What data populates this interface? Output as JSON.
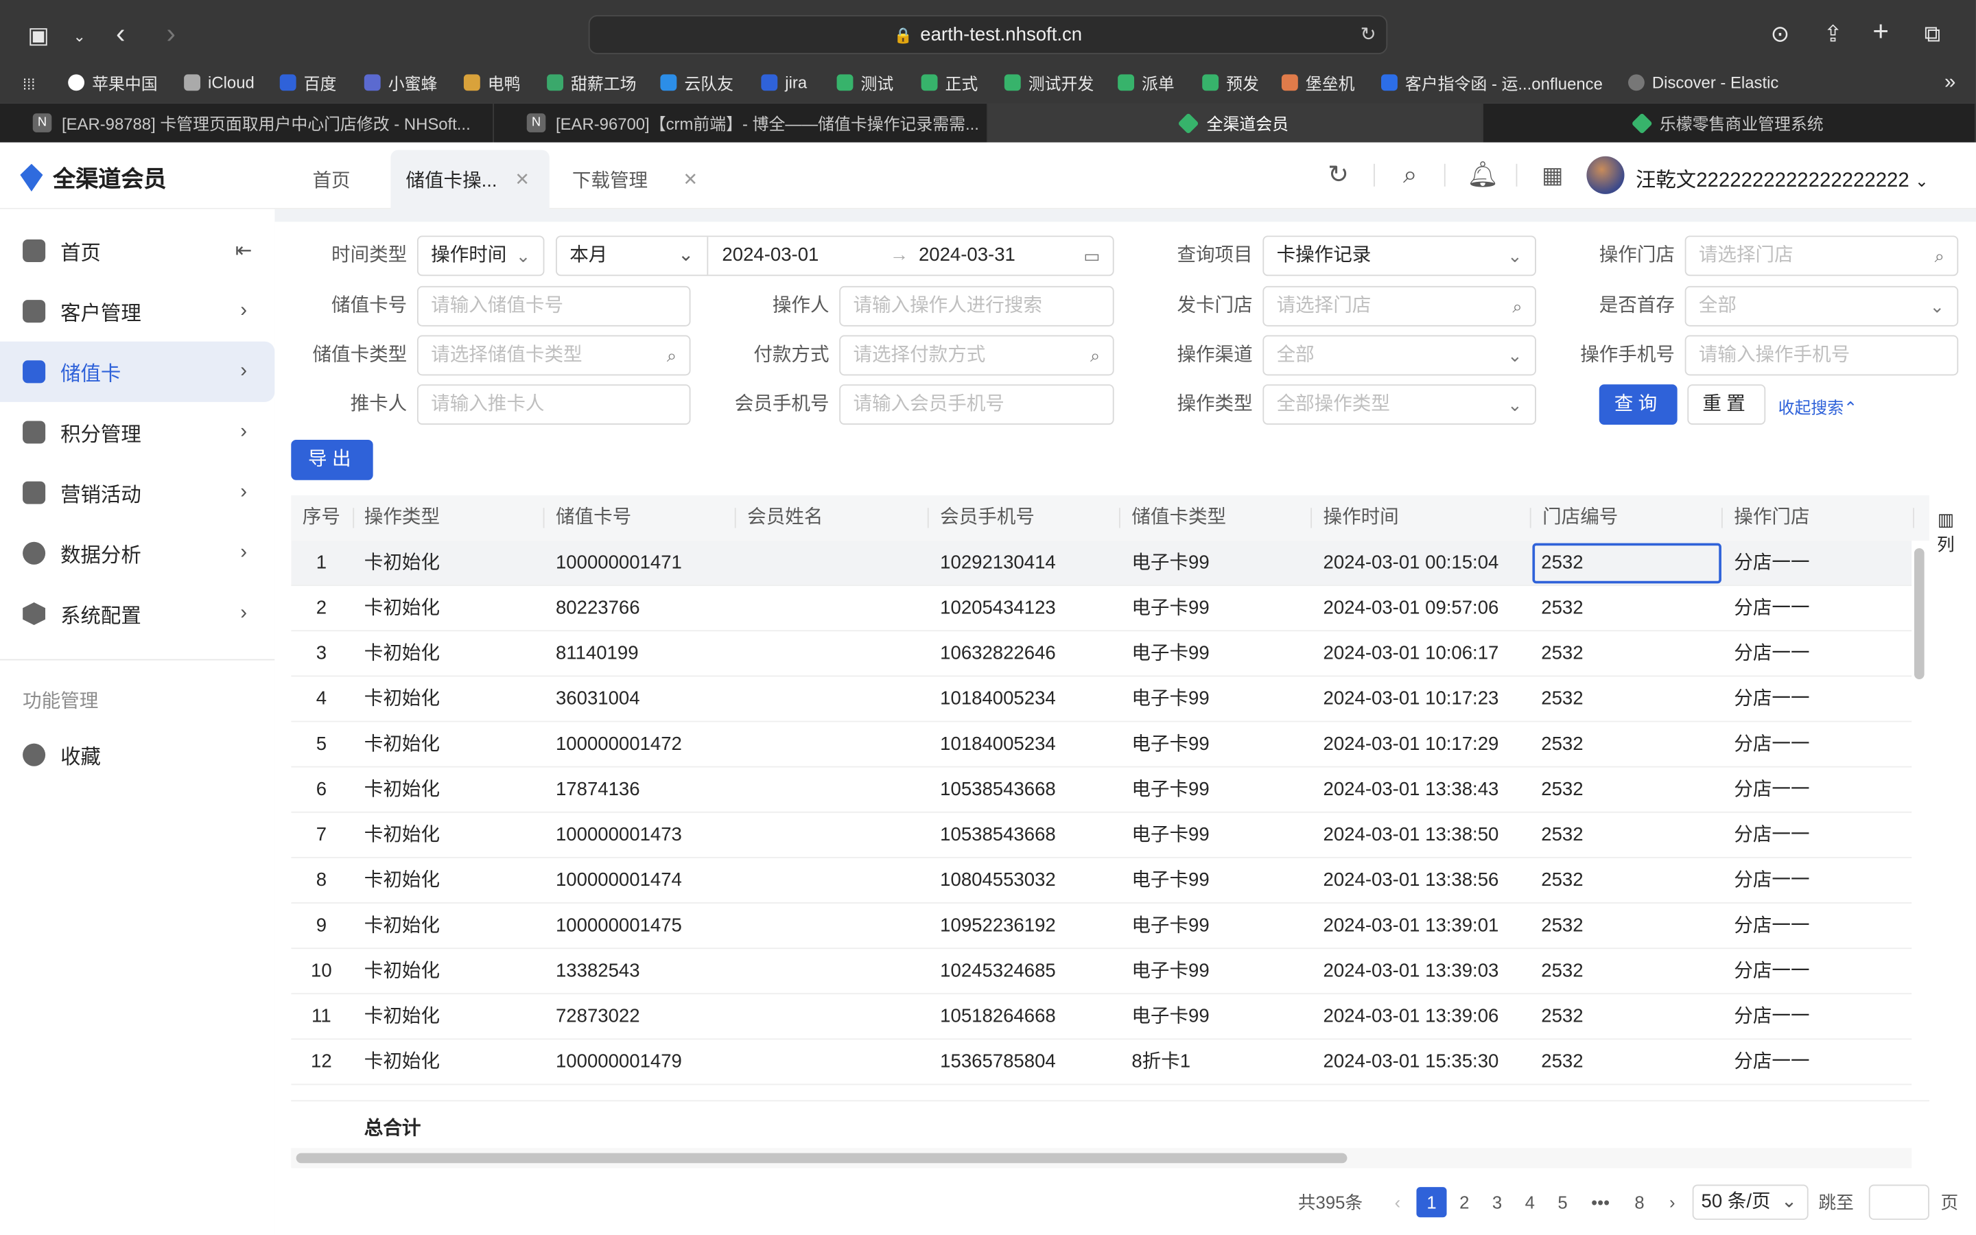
{
  "browser": {
    "url": "earth-test.nhsoft.cn",
    "bookmarks": [
      "苹果中国",
      "iCloud",
      "百度",
      "小蜜蜂",
      "电鸭",
      "甜薪工场",
      "云队友",
      "jira",
      "测试",
      "正式",
      "测试开发",
      "派单",
      "预发",
      "堡垒机",
      "客户指令函 - 运...onfluence",
      "Discover - Elastic"
    ],
    "tabs": [
      "[EAR-98788] 卡管理页面取用户中心门店修改 - NHSoft...",
      "[EAR-96700]【crm前端】- 博全——储值卡操作记录需需...",
      "全渠道会员",
      "乐檬零售商业管理系统"
    ]
  },
  "app": {
    "name": "全渠道会员",
    "page_tabs": [
      "首页",
      "储值卡操...",
      "下载管理"
    ],
    "user": "汪乾文2222222222222222222"
  },
  "sidebar": {
    "items": [
      "首页",
      "客户管理",
      "储值卡",
      "积分管理",
      "营销活动",
      "数据分析",
      "系统配置"
    ],
    "section_title": "功能管理",
    "fav": "收藏"
  },
  "filters": {
    "time_type_label": "时间类型",
    "time_type": "操作时间",
    "period": "本月",
    "date_start": "2024-03-01",
    "date_end": "2024-03-31",
    "query_item_label": "查询项目",
    "query_item": "卡操作记录",
    "op_store_label": "操作门店",
    "op_store_ph": "请选择门店",
    "card_no_label": "储值卡号",
    "card_no_ph": "请输入储值卡号",
    "operator_label": "操作人",
    "operator_ph": "请输入操作人进行搜索",
    "issue_store_label": "发卡门店",
    "issue_store_ph": "请选择门店",
    "first_deposit_label": "是否首存",
    "first_deposit": "全部",
    "card_type_label": "储值卡类型",
    "card_type_ph": "请选择储值卡类型",
    "pay_label": "付款方式",
    "pay_ph": "请选择付款方式",
    "channel_label": "操作渠道",
    "channel": "全部",
    "op_phone_label": "操作手机号",
    "op_phone_ph": "请输入操作手机号",
    "promoter_label": "推卡人",
    "promoter_ph": "请输入推卡人",
    "member_phone_label": "会员手机号",
    "member_phone_ph": "请输入会员手机号",
    "op_type_label": "操作类型",
    "op_type_ph": "全部操作类型",
    "query_btn": "查询",
    "reset_btn": "重置",
    "collapse": "收起搜索⌃",
    "export_btn": "导出"
  },
  "table": {
    "columns": [
      "序号",
      "操作类型",
      "储值卡号",
      "会员姓名",
      "会员手机号",
      "储值卡类型",
      "操作时间",
      "门店编号",
      "操作门店"
    ],
    "col_setting": "列",
    "rows": [
      [
        "1",
        "卡初始化",
        "100000001471",
        "",
        "10292130414",
        "电子卡99",
        "2024-03-01 00:15:04",
        "2532",
        "分店一一"
      ],
      [
        "2",
        "卡初始化",
        "80223766",
        "",
        "10205434123",
        "电子卡99",
        "2024-03-01 09:57:06",
        "2532",
        "分店一一"
      ],
      [
        "3",
        "卡初始化",
        "81140199",
        "",
        "10632822646",
        "电子卡99",
        "2024-03-01 10:06:17",
        "2532",
        "分店一一"
      ],
      [
        "4",
        "卡初始化",
        "36031004",
        "",
        "10184005234",
        "电子卡99",
        "2024-03-01 10:17:23",
        "2532",
        "分店一一"
      ],
      [
        "5",
        "卡初始化",
        "100000001472",
        "",
        "10184005234",
        "电子卡99",
        "2024-03-01 10:17:29",
        "2532",
        "分店一一"
      ],
      [
        "6",
        "卡初始化",
        "17874136",
        "",
        "10538543668",
        "电子卡99",
        "2024-03-01 13:38:43",
        "2532",
        "分店一一"
      ],
      [
        "7",
        "卡初始化",
        "100000001473",
        "",
        "10538543668",
        "电子卡99",
        "2024-03-01 13:38:50",
        "2532",
        "分店一一"
      ],
      [
        "8",
        "卡初始化",
        "100000001474",
        "",
        "10804553032",
        "电子卡99",
        "2024-03-01 13:38:56",
        "2532",
        "分店一一"
      ],
      [
        "9",
        "卡初始化",
        "100000001475",
        "",
        "10952236192",
        "电子卡99",
        "2024-03-01 13:39:01",
        "2532",
        "分店一一"
      ],
      [
        "10",
        "卡初始化",
        "13382543",
        "",
        "10245324685",
        "电子卡99",
        "2024-03-01 13:39:03",
        "2532",
        "分店一一"
      ],
      [
        "11",
        "卡初始化",
        "72873022",
        "",
        "10518264668",
        "电子卡99",
        "2024-03-01 13:39:06",
        "2532",
        "分店一一"
      ],
      [
        "12",
        "卡初始化",
        "100000001479",
        "",
        "15365785804",
        "8折卡1",
        "2024-03-01 15:35:30",
        "2532",
        "分店一一"
      ]
    ],
    "total_label": "总合计"
  },
  "pagination": {
    "total": "共395条",
    "pages": [
      "1",
      "2",
      "3",
      "4",
      "5",
      "•••",
      "8"
    ],
    "current": "1",
    "page_size": "50 条/页",
    "jump_label": "跳至",
    "page_suffix": "页"
  },
  "colors": {
    "primary": "#2f62d9",
    "chrome": "#383838"
  }
}
